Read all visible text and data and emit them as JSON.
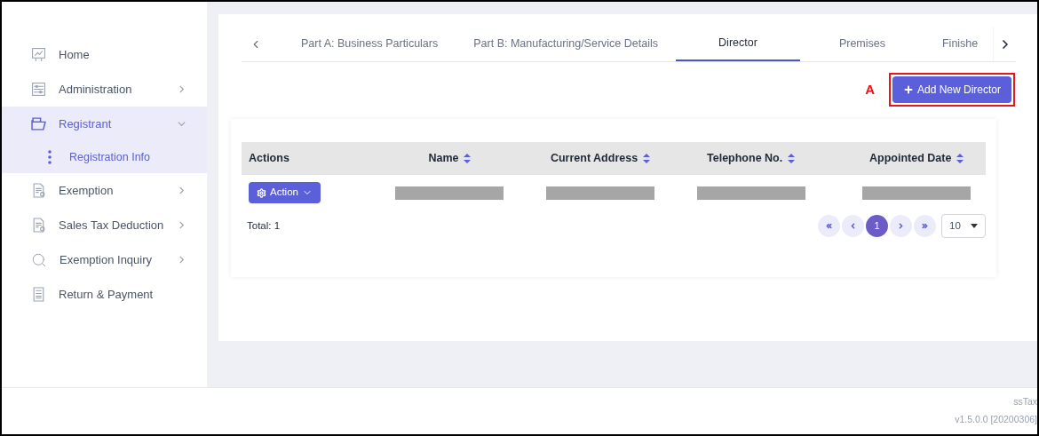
{
  "sidebar": {
    "items": [
      {
        "label": "Home",
        "kind": "chart",
        "selected": false
      },
      {
        "label": "Administration",
        "kind": "sliders",
        "expanded": false,
        "selected": false
      },
      {
        "label": "Registrant",
        "kind": "folder",
        "expanded": true,
        "selected": true,
        "children": [
          {
            "label": "Registration Info",
            "selected": true
          }
        ]
      },
      {
        "label": "Exemption",
        "kind": "document",
        "expanded": false,
        "selected": false
      },
      {
        "label": "Sales Tax Deduction",
        "kind": "document",
        "expanded": false,
        "selected": false
      },
      {
        "label": "Exemption Inquiry",
        "kind": "search",
        "expanded": false,
        "selected": false
      },
      {
        "label": "Return & Payment",
        "kind": "page",
        "selected": false
      }
    ]
  },
  "tabs": [
    {
      "label": "Part A: Business Particulars",
      "selected": false
    },
    {
      "label": "Part B: Manufacturing/Service Details",
      "selected": false
    },
    {
      "label": "Director",
      "selected": true
    },
    {
      "label": "Premises",
      "selected": false
    },
    {
      "label": "Finishe",
      "selected": false
    }
  ],
  "annotation": {
    "label": "A"
  },
  "add_button": {
    "label": "Add New Director"
  },
  "table": {
    "columns": [
      {
        "label": "Actions",
        "sortable": false
      },
      {
        "label": "Name",
        "sortable": true
      },
      {
        "label": "Current Address",
        "sortable": true
      },
      {
        "label": "Telephone No.",
        "sortable": true
      },
      {
        "label": "Appointed Date",
        "sortable": true
      }
    ],
    "rows": [
      {
        "action": "Action",
        "cells": [
          {
            "kind": "redacted"
          },
          {
            "kind": "redacted"
          },
          {
            "kind": "redacted"
          },
          {
            "kind": "redacted"
          }
        ]
      }
    ]
  },
  "total": "Total: 1",
  "pagination": {
    "pages": [
      {
        "label": "1",
        "selected": true
      }
    ],
    "page_size": "10"
  },
  "footer": {
    "app": "ssTax",
    "version": "v1.5.0.0 [20200306]"
  }
}
